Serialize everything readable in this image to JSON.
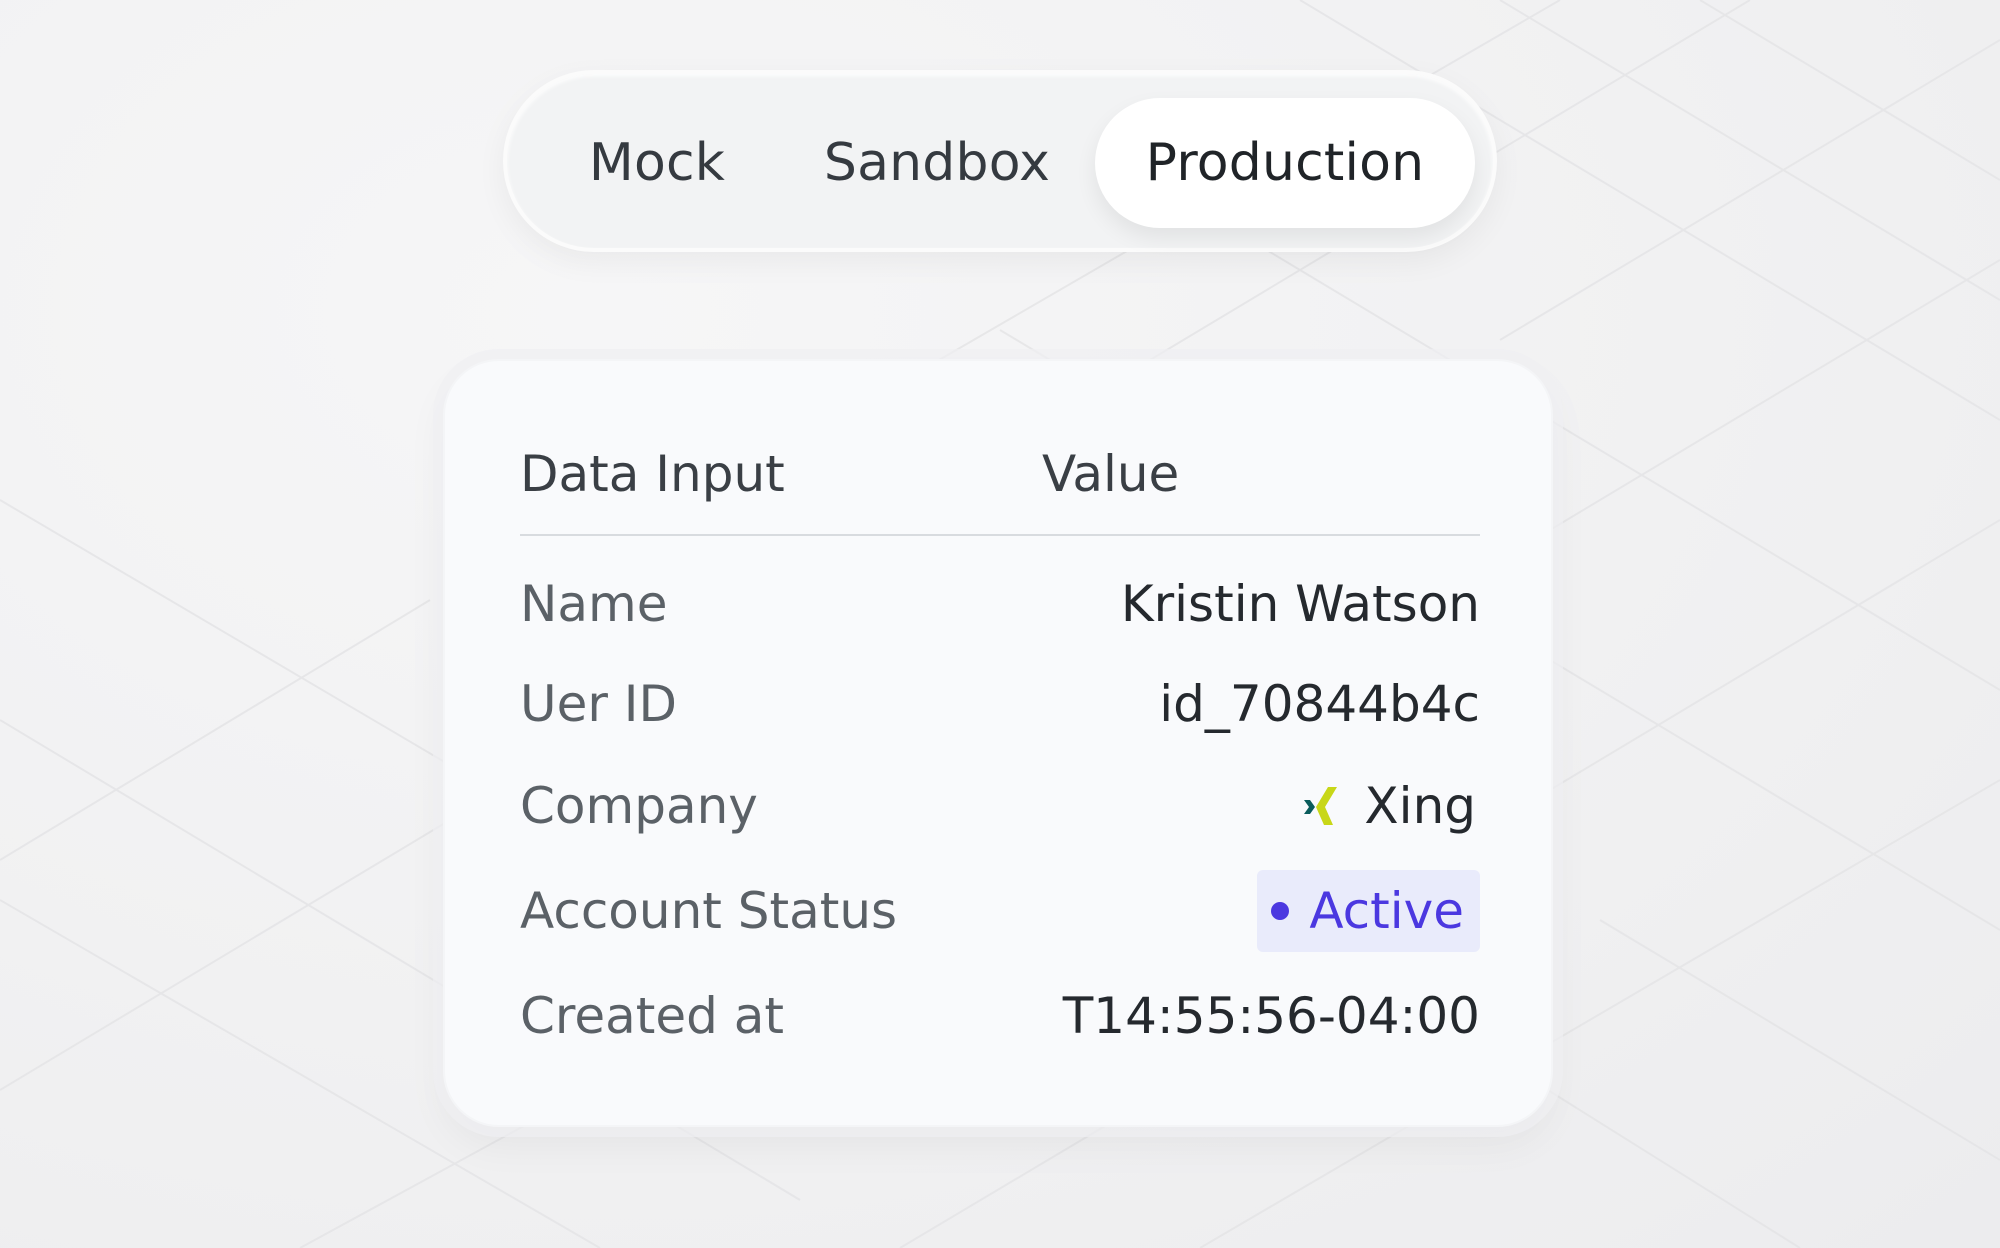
{
  "environments": {
    "tabs": [
      {
        "label": "Mock",
        "selected": false
      },
      {
        "label": "Sandbox",
        "selected": false
      },
      {
        "label": "Production",
        "selected": true
      }
    ]
  },
  "table": {
    "headers": {
      "input": "Data Input",
      "value": "Value"
    },
    "rows": [
      {
        "label": "Name",
        "value": "Kristin Watson"
      },
      {
        "label": "Uer ID",
        "value": "id_70844b4c"
      },
      {
        "label": "Company",
        "value": "Xing",
        "icon": "xing-logo-icon"
      },
      {
        "label": "Account Status",
        "value": "Active",
        "badge_color": "#4b38e0",
        "badge_bg": "#e9ebfb"
      },
      {
        "label": "Created at",
        "value": "T14:55:56-04:00"
      }
    ]
  },
  "colors": {
    "background": "#f1f1f2",
    "card": "#f9fafc",
    "accent": "#4b38e0",
    "xing_dark": "#0a5c5c",
    "xing_light": "#c8d718"
  }
}
